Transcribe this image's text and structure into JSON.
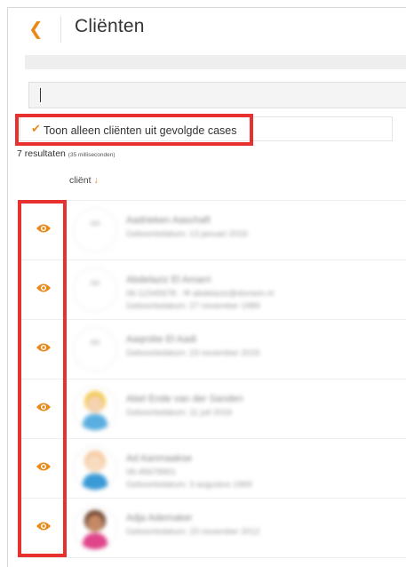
{
  "header": {
    "title": "Cliënten",
    "back_icon": "chevron-left-icon"
  },
  "search": {
    "value": ""
  },
  "filter": {
    "checked": true,
    "label": "Toon alleen cliënten uit gevolgde cases"
  },
  "results": {
    "count_text": "7 resultaten",
    "time_text": "(35 milliseconden)"
  },
  "table": {
    "column_header": "cliënt",
    "sort_indicator": "↓"
  },
  "clients": [
    {
      "initials": "AA",
      "name": "Aadrieken Aaschaft",
      "line1": "Geboortedatum: 13 januari 2016",
      "line2": "",
      "avatar": "initials"
    },
    {
      "initials": "AA",
      "name": "Abdelaziz El Amarri",
      "line1": "06-12345678  ·  ✉ abdelaziz@domein.nl",
      "line2": "Geboortedatum: 27 november 1989",
      "avatar": "initials"
    },
    {
      "initials": "AA",
      "name": "Aaqrobe El Aadi",
      "line1": "Geboortedatum: 23 november 2015",
      "line2": "",
      "avatar": "initials"
    },
    {
      "initials": "",
      "name": "Abel Ende van der Sanden",
      "line1": "Geboortedatum: 11 juli 2016",
      "line2": "",
      "avatar": "photo-blonde"
    },
    {
      "initials": "",
      "name": "Ad Aanmaakse",
      "line1": "06-45678901",
      "line2": "Geboortedatum: 3 augustus 1969",
      "avatar": "photo-light"
    },
    {
      "initials": "",
      "name": "Adja Ademaker",
      "line1": "Geboortedatum: 23 november 2012",
      "line2": "",
      "avatar": "photo-dark"
    }
  ],
  "colors": {
    "accent": "#e88a1a",
    "highlight": "#e8312f"
  }
}
